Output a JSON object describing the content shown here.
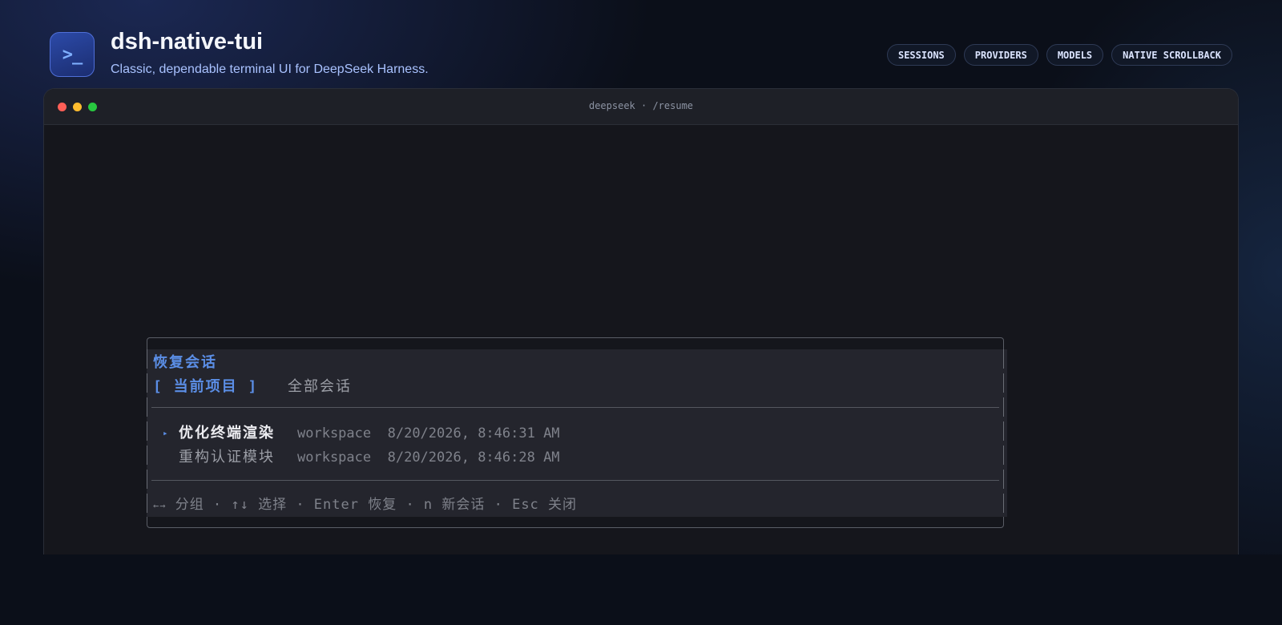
{
  "header": {
    "icon_glyph": ">_",
    "title": "dsh-native-tui",
    "subtitle": "Classic, dependable terminal UI for DeepSeek Harness."
  },
  "nav": [
    {
      "label": "SESSIONS"
    },
    {
      "label": "PROVIDERS"
    },
    {
      "label": "MODELS"
    },
    {
      "label": "NATIVE SCROLLBACK"
    }
  ],
  "window": {
    "title": "deepseek · /resume"
  },
  "dialog": {
    "title": "恢复会话",
    "tabs": [
      {
        "label": "[ 当前项目 ]",
        "active": true
      },
      {
        "label": "全部会话",
        "active": false
      }
    ],
    "sessions": [
      {
        "cursor": "▸",
        "name": "优化终端渲染",
        "location": "workspace",
        "timestamp": "8/20/2026, 8:46:31 AM",
        "selected": true
      },
      {
        "cursor": "",
        "name": "重构认证模块",
        "location": "workspace",
        "timestamp": "8/20/2026, 8:46:28 AM",
        "selected": false
      }
    ],
    "footer": {
      "arrows_glyph": "←→",
      "hint": " 分组 · ↑↓ 选择 · Enter 恢复 · n 新会话 · Esc 关闭"
    }
  },
  "colors": {
    "accent": "#5b8ee6",
    "background": "#0b0f19",
    "terminal_bg": "#15161c",
    "dialog_bg": "#24252d",
    "traffic_red": "#ff5f57",
    "traffic_yellow": "#febc2e",
    "traffic_green": "#28c840"
  },
  "icons": {
    "app": "terminal-prompt-icon",
    "cursor": "triangle-right-icon"
  }
}
